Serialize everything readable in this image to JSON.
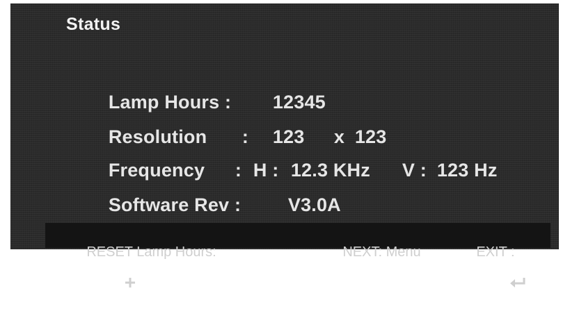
{
  "title": "Status",
  "rows": {
    "lamp": {
      "label": "Lamp Hours :",
      "value": "12345"
    },
    "resolution": {
      "label": "Resolution",
      "sep": ":",
      "h": "123",
      "x": "x",
      "v": "123"
    },
    "frequency": {
      "label": "Frequency",
      "sep": ":",
      "h_label": "H :",
      "h_value": "12.3 KHz",
      "v_label": "V :",
      "v_value": "123 Hz"
    },
    "software": {
      "label": "Software Rev :",
      "value": "V3.0A"
    }
  },
  "footer": {
    "reset_label": "RESET Lamp Hours:",
    "reset_icon": "plus-icon",
    "next_label": "NEXT: Menu",
    "exit_label": "EXIT :",
    "exit_icon": "enter-arrow-icon"
  },
  "colors": {
    "background": "#2b2b2b",
    "footer_background": "#141414",
    "text": "#e6e6e6"
  }
}
